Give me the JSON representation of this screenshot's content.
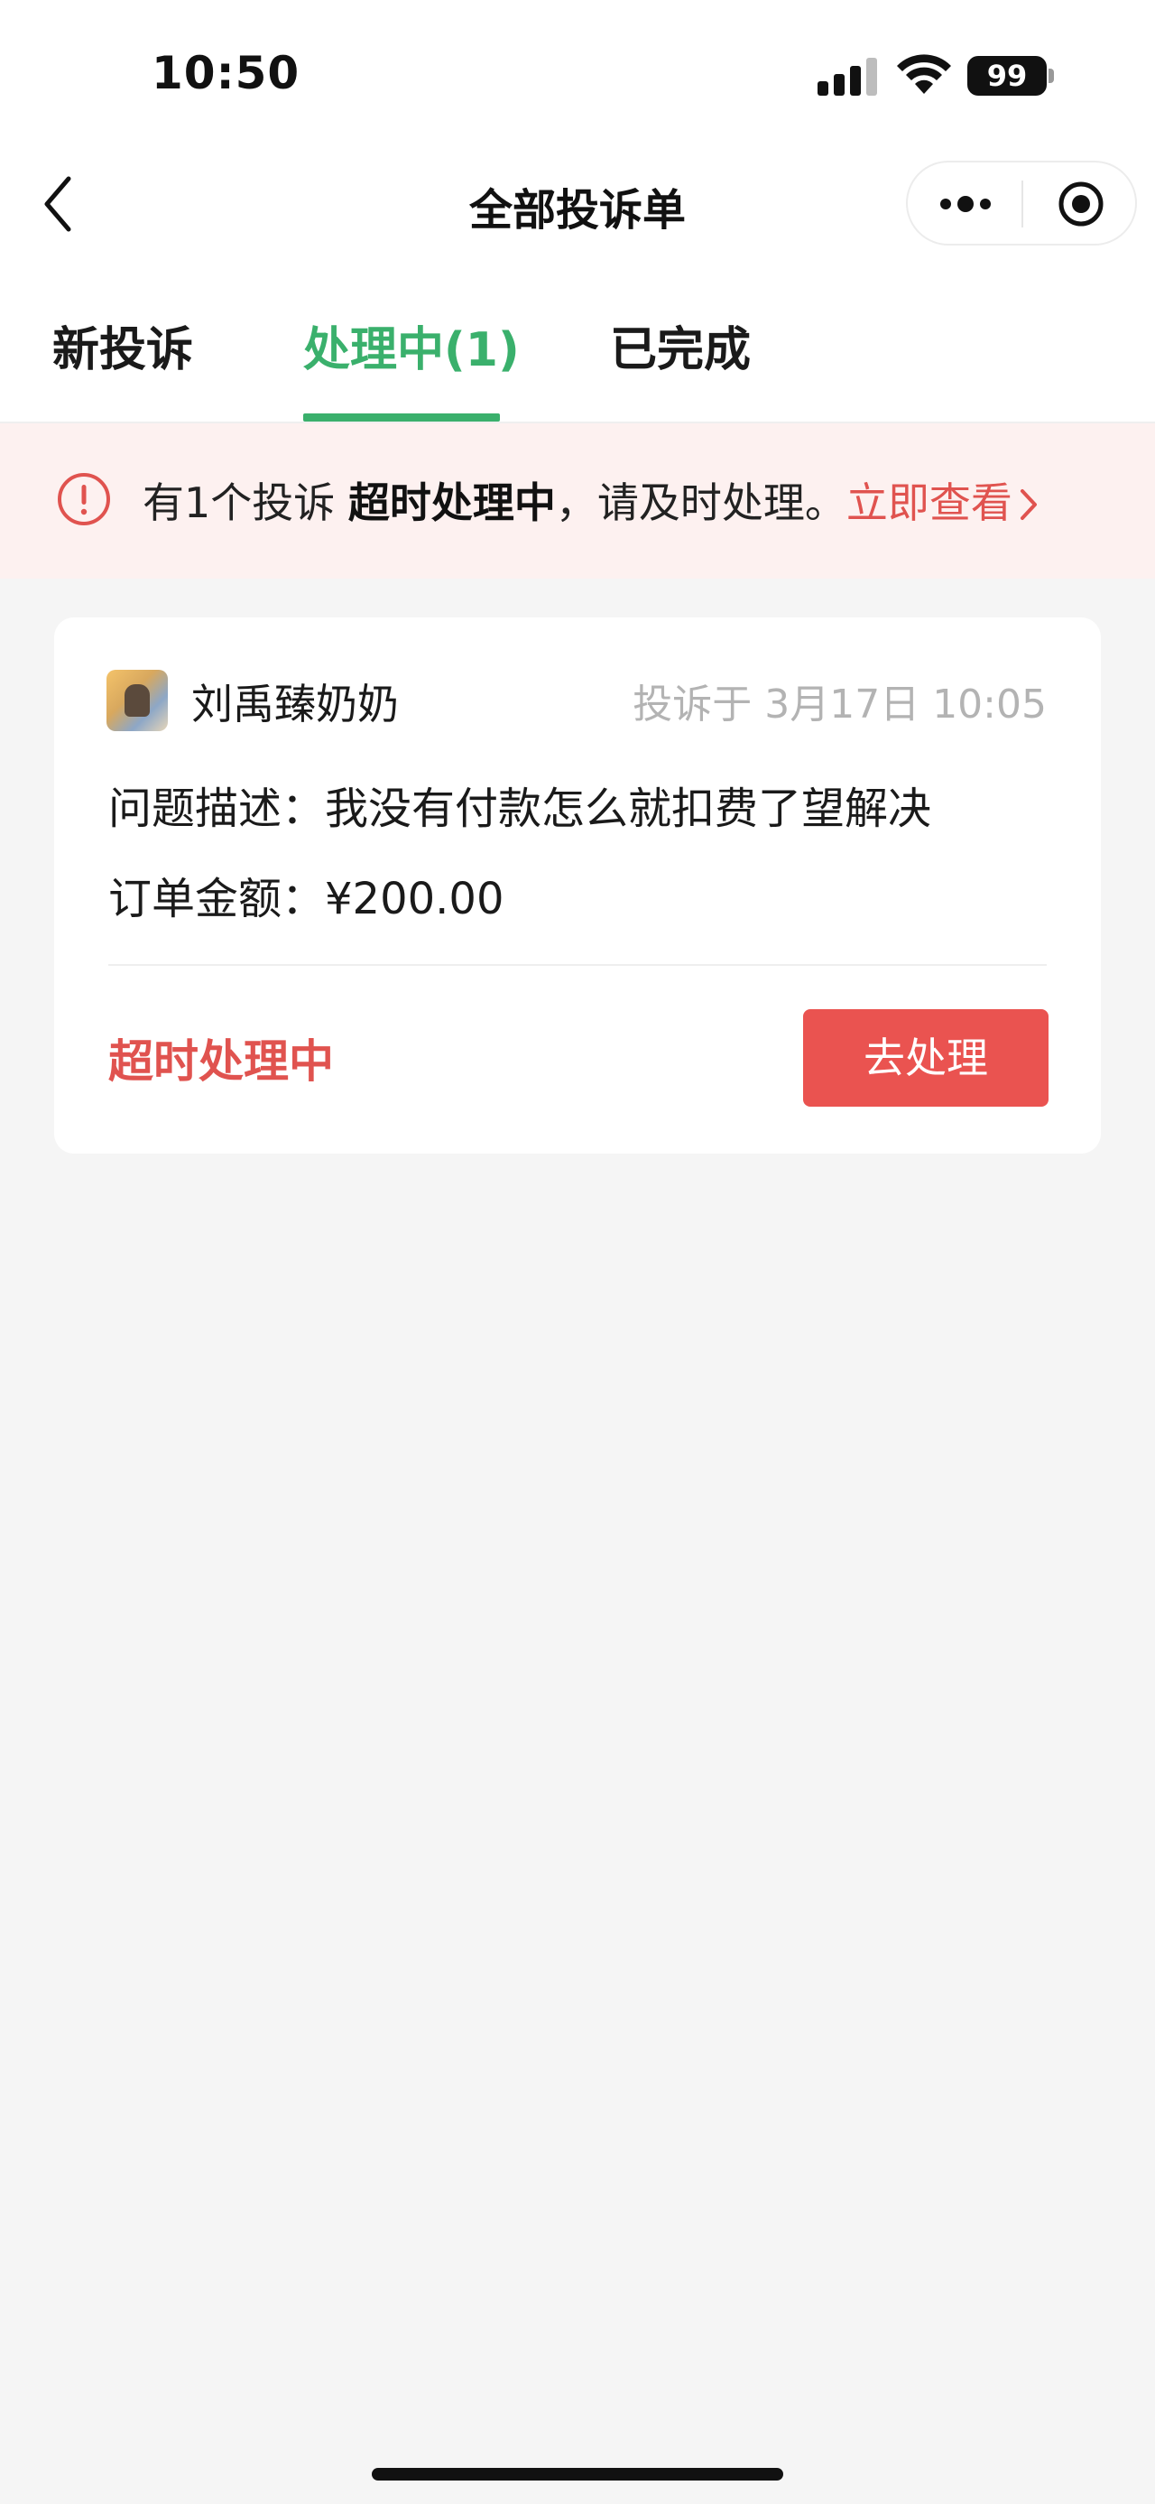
{
  "status_bar": {
    "time": "10:50",
    "battery_level": "99",
    "icons": [
      "signal-icon",
      "wifi-icon",
      "battery-icon"
    ]
  },
  "nav": {
    "title": "全部投诉单",
    "back_icon": "chevron-left-icon",
    "capsule_icons": [
      "more-icon",
      "target-icon"
    ]
  },
  "tabs": [
    {
      "label": "新投诉",
      "active": false
    },
    {
      "label": "处理中(1)",
      "active": true
    },
    {
      "label": "已完成",
      "active": false
    }
  ],
  "alert": {
    "prefix": "有1个投诉 ",
    "emphasis": "超时处理中",
    "suffix": "，请及时处理。",
    "link_label": "立即查看",
    "icon": "exclamation-circle-icon"
  },
  "complaint": {
    "user_name": "刘禹臻奶奶",
    "complained_at": "投诉于 3月17日 10:05",
    "description_label": "问题描述：",
    "description": "我没有付款怎么就扣费了望解决",
    "amount_label": "订单金额：",
    "amount": "¥200.00",
    "status": "超时处理中",
    "action_label": "去处理"
  },
  "colors": {
    "accent_green": "#3ab06c",
    "alert_red": "#e0534f",
    "button_red": "#ea5350",
    "alert_bg": "#fdf1f0",
    "page_bg": "#f5f5f5"
  }
}
